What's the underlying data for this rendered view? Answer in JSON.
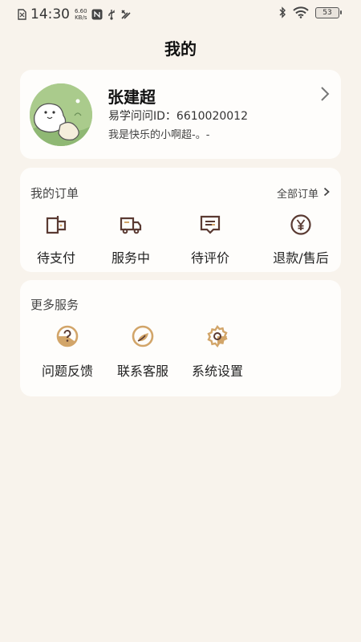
{
  "status_bar": {
    "time": "14:30",
    "net_speed_value": "6.60",
    "net_speed_unit": "KB/s",
    "battery": "53",
    "icons": [
      "no-sim-icon",
      "nfc-icon",
      "usb-icon",
      "tools-icon",
      "bluetooth-icon",
      "wifi-icon",
      "battery-icon"
    ]
  },
  "header": {
    "title": "我的"
  },
  "profile": {
    "name": "张建超",
    "id_text": "易学问问ID：6610020012",
    "signature": "我是快乐的小啊超-。-",
    "chevron_icon": "chevron-right-icon"
  },
  "orders": {
    "title": "我的订单",
    "all_label": "全部订单",
    "items": [
      {
        "label": "待支付",
        "icon": "wallet-icon"
      },
      {
        "label": "服务中",
        "icon": "truck-icon"
      },
      {
        "label": "待评价",
        "icon": "review-icon"
      },
      {
        "label": "退款/售后",
        "icon": "yen-icon"
      }
    ]
  },
  "services": {
    "title": "更多服务",
    "items": [
      {
        "label": "问题反馈",
        "icon": "question-icon"
      },
      {
        "label": "联系客服",
        "icon": "chat-bubble-icon"
      },
      {
        "label": "系统设置",
        "icon": "gear-icon"
      }
    ]
  },
  "colors": {
    "background": "#f8f3ec",
    "card": "#fefdfb",
    "icon_brown": "#5a3a32",
    "icon_gold": "#d2a569"
  }
}
